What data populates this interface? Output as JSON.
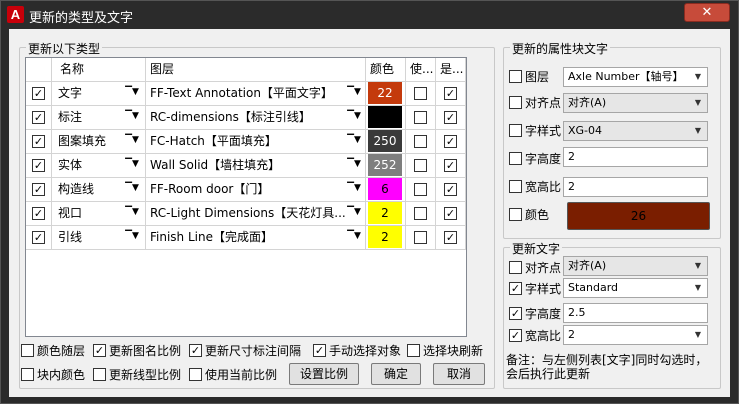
{
  "window": {
    "title": "更新的类型及文字",
    "close_label": "✕"
  },
  "left_group": {
    "title": "更新以下类型"
  },
  "grid": {
    "headers": [
      "名称",
      "图层",
      "颜色",
      "使...",
      "是..."
    ],
    "rows": [
      {
        "name": "文字",
        "layer": "FF-Text Annotation【平面文字】",
        "color": "22",
        "color_hex": "#c43a0c",
        "color_text": "#ffffff"
      },
      {
        "name": "标注",
        "layer": "RC-dimensions【标注引线】",
        "color": "",
        "color_hex": "#000000",
        "color_text": "#ffffff"
      },
      {
        "name": "图案填充",
        "layer": "FC-Hatch【平面填充】",
        "color": "250",
        "color_hex": "#3a3a3a",
        "color_text": "#ffffff"
      },
      {
        "name": "实体",
        "layer": "Wall Solid【墙柱填充】",
        "color": "252",
        "color_hex": "#7e7e7e",
        "color_text": "#ffffff"
      },
      {
        "name": "构造线",
        "layer": "FF-Room door【门】",
        "color": "6",
        "color_hex": "#ff00ff",
        "color_text": "#000000"
      },
      {
        "name": "视口",
        "layer": "RC-Light Dimensions【天花灯具...",
        "color": "2",
        "color_hex": "#ffff00",
        "color_text": "#000000"
      },
      {
        "name": "引线",
        "layer": "Finish Line【完成面】",
        "color": "2",
        "color_hex": "#ffff00",
        "color_text": "#000000"
      }
    ]
  },
  "bottom_options": {
    "row1": [
      {
        "label": "颜色随层",
        "checked": false
      },
      {
        "label": "更新图名比例",
        "checked": true
      },
      {
        "label": "更新尺寸标注间隔",
        "checked": true
      },
      {
        "label": "手动选择对象",
        "checked": true
      },
      {
        "label": "选择块刷新",
        "checked": false
      }
    ],
    "row2": [
      {
        "label": "块内颜色",
        "checked": false
      },
      {
        "label": "更新线型比例",
        "checked": false
      },
      {
        "label": "使用当前比例",
        "checked": false
      }
    ],
    "buttons": {
      "scale": "设置比例",
      "ok": "确定",
      "cancel": "取消"
    }
  },
  "attr_group": {
    "title": "更新的属性块文字",
    "layer_label": "图层",
    "layer_value": "Axle Number【轴号】",
    "align_label": "对齐点",
    "align_value": "对齐(A)",
    "style_label": "字样式",
    "style_value": "XG-04",
    "height_label": "字高度",
    "height_value": "2",
    "width_label": "宽高比",
    "width_value": "2",
    "color_label": "颜色",
    "color_value": "26",
    "color_hex": "#7a1e00"
  },
  "text_group": {
    "title": "更新文字",
    "align_label": "对齐点",
    "align_value": "对齐(A)",
    "style_label": "字样式",
    "style_value": "Standard",
    "height_label": "字高度",
    "height_value": "2.5",
    "width_label": "宽高比",
    "width_value": "2",
    "note": "备注：与左侧列表[文字]同时勾选时，会后执行此更新"
  }
}
